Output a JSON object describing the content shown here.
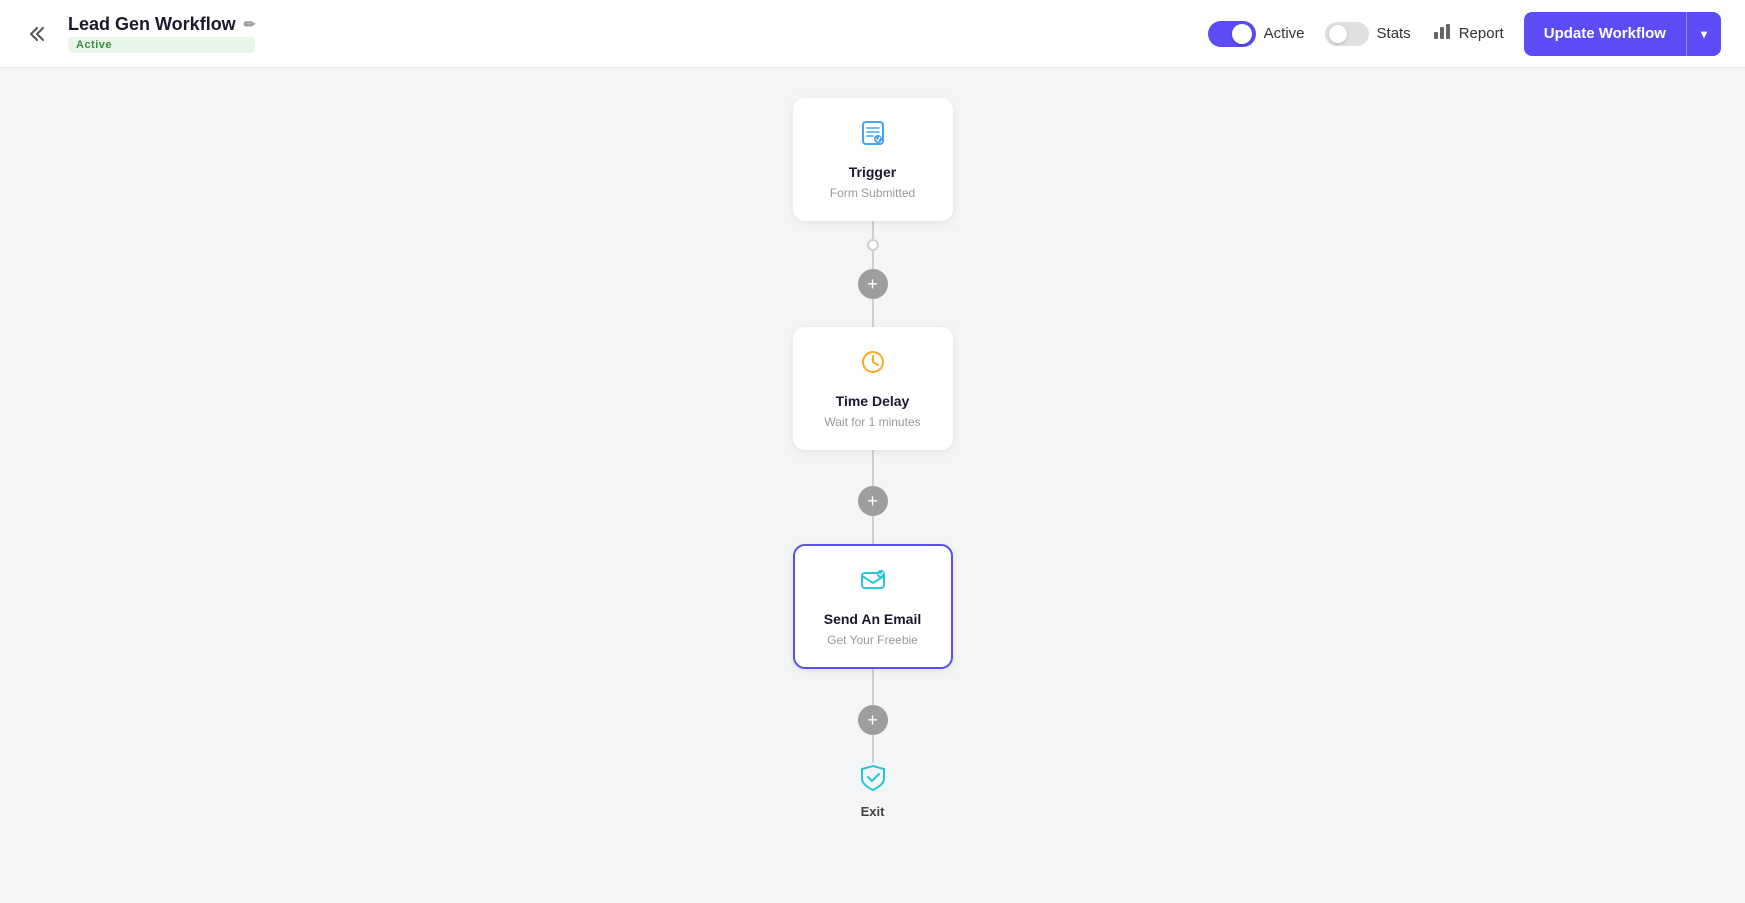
{
  "header": {
    "back_label": "<<",
    "title": "Lead Gen Workflow",
    "edit_icon": "✏",
    "active_badge": "Active",
    "toggle_active_label": "Active",
    "stats_label": "Stats",
    "report_label": "Report",
    "update_button_label": "Update Workflow"
  },
  "workflow": {
    "nodes": [
      {
        "id": "trigger",
        "title": "Trigger",
        "subtitle": "Form Submitted",
        "icon": "📋",
        "selected": false
      },
      {
        "id": "time-delay",
        "title": "Time Delay",
        "subtitle": "Wait for 1 minutes",
        "icon": "⏰",
        "selected": false
      },
      {
        "id": "send-email",
        "title": "Send An Email",
        "subtitle": "Get Your Freebie",
        "icon": "✉",
        "selected": true
      }
    ],
    "exit_label": "Exit",
    "add_btn_label": "+"
  }
}
